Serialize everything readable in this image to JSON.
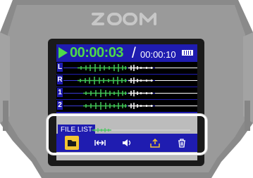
{
  "device": {
    "brand": "ZOOM"
  },
  "display": {
    "elapsed_time": "00:00:03",
    "separator": "/",
    "total_time": "00:00:10",
    "tracks": [
      {
        "label": "L"
      },
      {
        "label": "R"
      },
      {
        "label": "1"
      },
      {
        "label": "2"
      }
    ],
    "file_list_label": "FILE LIST",
    "menu": [
      {
        "icon": "folder-icon",
        "selected": true
      },
      {
        "icon": "trim-icon",
        "selected": false
      },
      {
        "icon": "volume-icon",
        "selected": false
      },
      {
        "icon": "export-icon",
        "selected": false
      },
      {
        "icon": "trash-icon",
        "selected": false
      }
    ]
  },
  "colors": {
    "screen": "#1f1cb0",
    "timer": "#4fd94a",
    "selected": "#f3c531"
  }
}
